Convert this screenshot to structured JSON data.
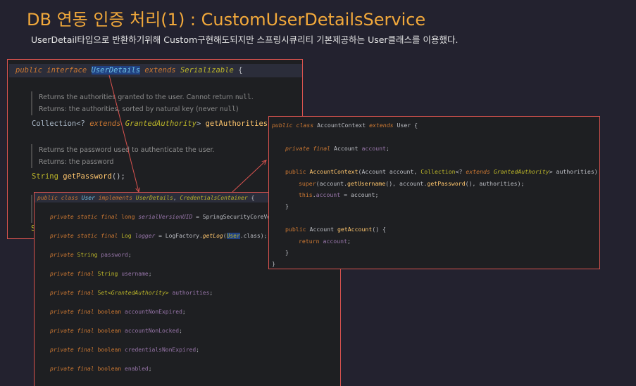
{
  "header": {
    "title": "DB 연동 인증 처리(1) : CustomUserDetailsService",
    "subtitle": "UserDetail타입으로 반환하기위해 Custom구현해도되지만 스프링시큐리티 기본제공하는 User클래스를 이용했다."
  },
  "userDetails": {
    "public": "public",
    "interface": "interface",
    "name": "UserDetails",
    "extends": "extends",
    "parent": "Serializable",
    "brace": "{",
    "doc1_line1_text": "Returns the authorities granted to the user. Cannot return ",
    "doc1_line1_code": "null",
    "doc1_line1_end": ".",
    "doc1_line2_text": "Returns: the authorities, sorted by natural key (never ",
    "doc1_line2_code": "null",
    "doc1_line2_end": ")",
    "m1_type": "Collection<? ",
    "m1_extends": "extends",
    "m1_generic": "GrantedAuthority",
    "m1_gt": ">",
    "m1_name": "getAuthorities",
    "m1_tail": "();",
    "doc2_line1": "Returns the password used to authenticate the user.",
    "doc2_line2": "Returns: the password",
    "m2_type": "String",
    "m2_name": "getPassword",
    "m2_tail": "();",
    "partial_char": "S"
  },
  "user": {
    "decl_public": "public",
    "decl_class": "class",
    "decl_name": "User",
    "decl_implements": "implements",
    "decl_iface1": "UserDetails",
    "decl_comma": ",",
    "decl_iface2": "CredentialsContainer",
    "decl_brace": "{",
    "f1_mods": "private static final",
    "f1_type": "long",
    "f1_name": "serialVersionUID",
    "f1_rest": "= SpringSecurityCoreVersion",
    "f2_mods": "private static final",
    "f2_type": "Log",
    "f2_name": "logger",
    "f2_rest": "= LogFactory.",
    "f2_call": "getLog",
    "f2_paren": "(",
    "f2_arg": "User",
    "f2_end": ".class);",
    "f3_mods": "private",
    "f3_type": "String",
    "f3_name": "password",
    "f4_mods": "private final",
    "f4_type": "String",
    "f4_name": "username",
    "f5_mods": "private final",
    "f5_type": "Set<",
    "f5_generic": "GrantedAuthority",
    "f5_gt": ">",
    "f5_name": "authorities",
    "f6_mods": "private final",
    "f6_type": "boolean",
    "f6_name": "accountNonExpired",
    "f7_mods": "private final",
    "f7_type": "boolean",
    "f7_name": "accountNonLocked",
    "f8_mods": "private final",
    "f8_type": "boolean",
    "f8_name": "credentialsNonExpired",
    "f9_mods": "private final",
    "f9_type": "boolean",
    "f9_name": "enabled",
    "semicolon": ";"
  },
  "accountContext": {
    "l1_public": "public",
    "l1_class": "class",
    "l1_name": "AccountContext",
    "l1_extends": "extends",
    "l1_parent": "User",
    "l1_brace": "{",
    "l2_mods": "private final",
    "l2_type": "Account",
    "l2_name": "account",
    "l2_end": ";",
    "l3_public": "public",
    "l3_name": "AccountContext",
    "l3_open": "(Account account, ",
    "l3_coll": "Collection",
    "l3_q": "<? ",
    "l3_extends": "extends",
    "l3_generic": "GrantedAuthority",
    "l3_close": "> authorities) {",
    "l4_super": "super",
    "l4_open": "(account.",
    "l4_m1": "getUsername",
    "l4_mid": "(), account.",
    "l4_m2": "getPassword",
    "l4_end": "(), authorities);",
    "l5_this": "this",
    "l5_dot": ".",
    "l5_field": "account",
    "l5_rest": " = account;",
    "close_brace": "}",
    "l7_public": "public",
    "l7_type": "Account",
    "l7_name": "getAccount",
    "l7_tail": "() {",
    "l8_return": "return",
    "l8_field": "account",
    "l8_end": ";"
  },
  "colors": {
    "title": "#f2a93b",
    "panel_border": "#d9534f",
    "background": "#23222f",
    "arrow": "#d9534f"
  }
}
